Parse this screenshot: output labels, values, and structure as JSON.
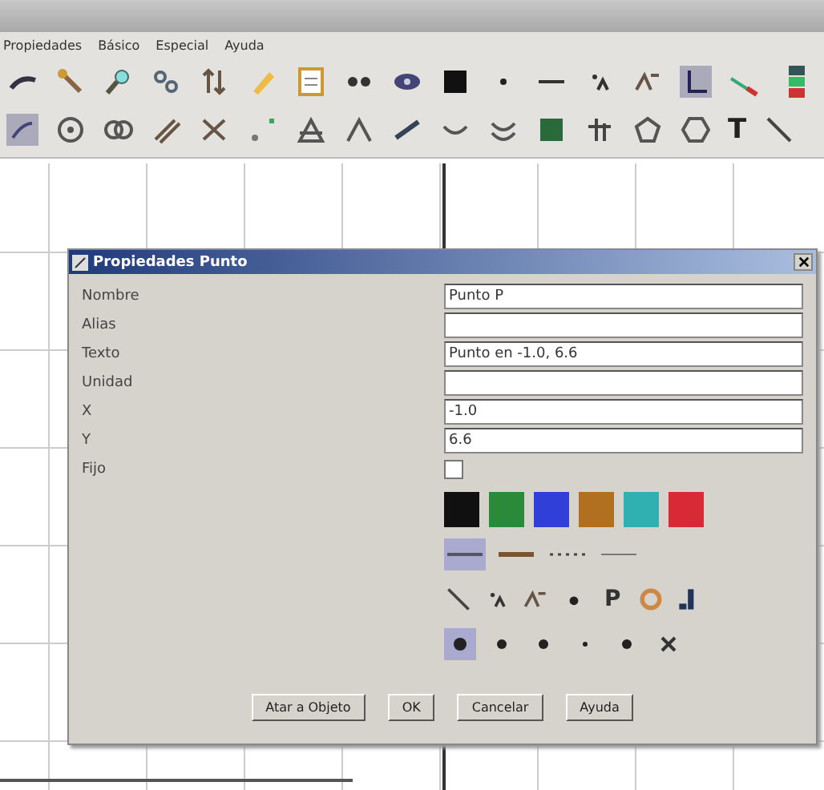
{
  "menu": [
    "Propiedades",
    "Básico",
    "Especial",
    "Ayuda"
  ],
  "toolbar": {
    "text_tool": "T"
  },
  "dialog": {
    "title": "Propiedades Punto",
    "fields": [
      {
        "kind": "text",
        "label": "Nombre",
        "value": "Punto P"
      },
      {
        "kind": "text",
        "label": "Alias"
      },
      {
        "kind": "text",
        "label": "Texto",
        "value": "Punto en -1.0, 6.6"
      },
      {
        "kind": "text",
        "label": "Unidad"
      },
      {
        "kind": "text",
        "label": "X",
        "value": "-1.0"
      },
      {
        "kind": "text",
        "label": "Y",
        "value": "6.6"
      },
      {
        "kind": "checkbox",
        "label": "Fijo",
        "checked": false
      }
    ],
    "colors": [
      {
        "color": "#101010",
        "selected": false
      },
      {
        "color": "#2a8a3a",
        "selected": false
      },
      {
        "color": "#2f3fd8",
        "selected": false
      },
      {
        "color": "#b07020",
        "selected": false
      },
      {
        "color": "#30b0b0",
        "selected": false
      },
      {
        "color": "#d82a36",
        "selected": false
      }
    ],
    "line_styles": [
      {
        "kind": "solid",
        "selected": true
      },
      {
        "kind": "thick",
        "selected": false
      },
      {
        "kind": "dotted",
        "selected": false
      },
      {
        "kind": "thin",
        "selected": false
      }
    ],
    "tool_text": "P",
    "point_styles": [
      {
        "kind": "big",
        "selected": true
      },
      {
        "kind": "medium",
        "selected": false
      },
      {
        "kind": "medium",
        "selected": false
      },
      {
        "kind": "small",
        "selected": false
      },
      {
        "kind": "medium",
        "selected": false
      },
      {
        "kind": "cross",
        "selected": false
      }
    ],
    "buttons": [
      "Atar a Objeto",
      "OK",
      "Cancelar",
      "Ayuda"
    ]
  }
}
